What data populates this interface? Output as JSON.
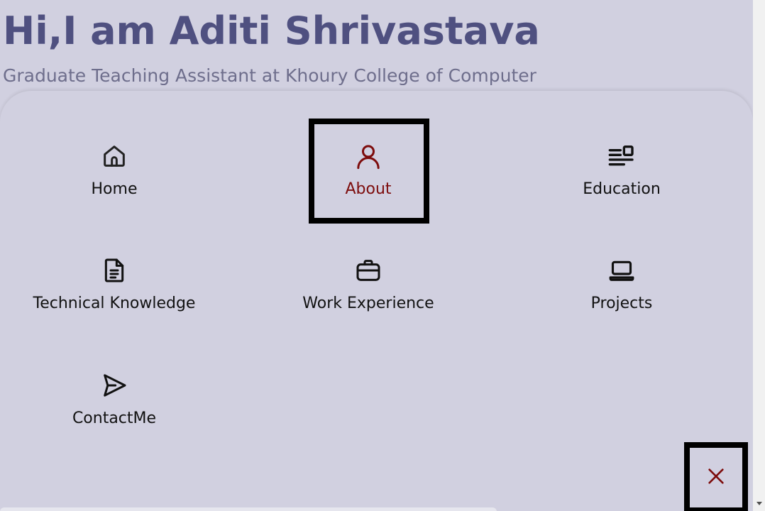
{
  "hero": {
    "title": "Hi,I am Aditi Shrivastava",
    "subtitle": "Graduate Teaching Assistant at Khoury College of Computer"
  },
  "menu": {
    "items": [
      {
        "label": "Home",
        "icon": "home-icon"
      },
      {
        "label": "About",
        "icon": "user-icon",
        "active": true
      },
      {
        "label": "Education",
        "icon": "news-icon"
      },
      {
        "label": "Technical Knowledge",
        "icon": "document-icon"
      },
      {
        "label": "Work Experience",
        "icon": "briefcase-icon"
      },
      {
        "label": "Projects",
        "icon": "laptop-icon"
      },
      {
        "label": "ContactMe",
        "icon": "send-icon"
      }
    ],
    "close_icon": "close-icon"
  },
  "colors": {
    "background": "#d1d0e0",
    "title": "#4f5080",
    "subtitle": "#6e6e8c",
    "active": "#7d0c0c",
    "text": "#111111"
  }
}
